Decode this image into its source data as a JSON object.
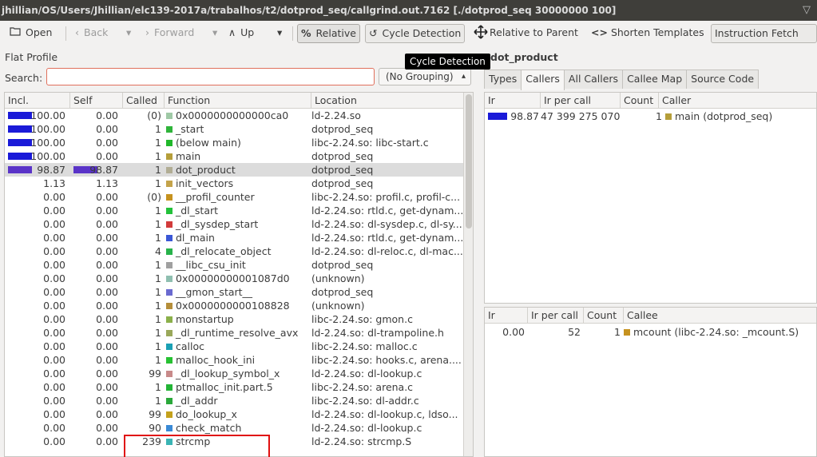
{
  "window": {
    "title": "jhillian/OS/Users/Jhillian/elc139-2017a/trabalhos/t2/dotprod_seq/callgrind.out.7162 [./dotprod_seq 30000000 100]"
  },
  "toolbar": {
    "open": "Open",
    "back": "Back",
    "forward": "Forward",
    "up": "Up",
    "relative": "Relative",
    "cycle_detection": "Cycle Detection",
    "relative_to_parent": "Relative to Parent",
    "shorten_templates": "Shorten Templates",
    "event_type": "Instruction Fetch"
  },
  "flat_profile": {
    "title": "Flat Profile",
    "search_label": "Search:",
    "search_value": "",
    "grouping": "(No Grouping)",
    "columns": [
      "Incl.",
      "Self",
      "Called",
      "Function",
      "Location"
    ],
    "rows": [
      {
        "incl": "100.00",
        "incl_frac": 1.0,
        "self": "0.00",
        "self_frac": 0.0,
        "called": "(0)",
        "func": "0x0000000000000ca0",
        "loc": "ld-2.24.so",
        "color": "#9fc9a6"
      },
      {
        "incl": "100.00",
        "incl_frac": 1.0,
        "self": "0.00",
        "self_frac": 0.0,
        "called": "1",
        "func": "_start",
        "loc": "dotprod_seq",
        "color": "#2fb43a"
      },
      {
        "incl": "100.00",
        "incl_frac": 1.0,
        "self": "0.00",
        "self_frac": 0.0,
        "called": "1",
        "func": "(below main)",
        "loc": "libc-2.24.so: libc-start.c",
        "color": "#21b82b"
      },
      {
        "incl": "100.00",
        "incl_frac": 1.0,
        "self": "0.00",
        "self_frac": 0.0,
        "called": "1",
        "func": "main",
        "loc": "dotprod_seq",
        "color": "#b59e3a"
      },
      {
        "incl": "98.87",
        "incl_frac": 0.9887,
        "self": "98.87",
        "self_frac": 0.9887,
        "called": "1",
        "func": "dot_product",
        "loc": "dotprod_seq",
        "color": "#b1ad94",
        "selected": true
      },
      {
        "incl": "1.13",
        "incl_frac": 0.0,
        "self": "1.13",
        "self_frac": 0.0,
        "called": "1",
        "func": "init_vectors",
        "loc": "dotprod_seq",
        "color": "#c4a34a"
      },
      {
        "incl": "0.00",
        "incl_frac": 0.0,
        "self": "0.00",
        "self_frac": 0.0,
        "called": "(0)",
        "func": "__profil_counter",
        "loc": "libc-2.24.so: profil.c, profil-c...",
        "color": "#c6921f"
      },
      {
        "incl": "0.00",
        "incl_frac": 0.0,
        "self": "0.00",
        "self_frac": 0.0,
        "called": "1",
        "func": "_dl_start",
        "loc": "ld-2.24.so: rtld.c, get-dynam...",
        "color": "#23c13a"
      },
      {
        "incl": "0.00",
        "incl_frac": 0.0,
        "self": "0.00",
        "self_frac": 0.0,
        "called": "1",
        "func": "_dl_sysdep_start",
        "loc": "ld-2.24.so: dl-sysdep.c, dl-sy...",
        "color": "#d23b3b"
      },
      {
        "incl": "0.00",
        "incl_frac": 0.0,
        "self": "0.00",
        "self_frac": 0.0,
        "called": "1",
        "func": "dl_main",
        "loc": "ld-2.24.so: rtld.c, get-dynam...",
        "color": "#3a57d6"
      },
      {
        "incl": "0.00",
        "incl_frac": 0.0,
        "self": "0.00",
        "self_frac": 0.0,
        "called": "4",
        "func": "_dl_relocate_object",
        "loc": "ld-2.24.so: dl-reloc.c, dl-mac...",
        "color": "#27b24a"
      },
      {
        "incl": "0.00",
        "incl_frac": 0.0,
        "self": "0.00",
        "self_frac": 0.0,
        "called": "1",
        "func": "__libc_csu_init",
        "loc": "dotprod_seq",
        "color": "#a0a0a0"
      },
      {
        "incl": "0.00",
        "incl_frac": 0.0,
        "self": "0.00",
        "self_frac": 0.0,
        "called": "1",
        "func": "0x00000000001087d0",
        "loc": "(unknown)",
        "color": "#8fbfb0"
      },
      {
        "incl": "0.00",
        "incl_frac": 0.0,
        "self": "0.00",
        "self_frac": 0.0,
        "called": "1",
        "func": "__gmon_start__",
        "loc": "dotprod_seq",
        "color": "#6a6ad0"
      },
      {
        "incl": "0.00",
        "incl_frac": 0.0,
        "self": "0.00",
        "self_frac": 0.0,
        "called": "1",
        "func": "0x0000000000108828",
        "loc": "(unknown)",
        "color": "#b58e3a"
      },
      {
        "incl": "0.00",
        "incl_frac": 0.0,
        "self": "0.00",
        "self_frac": 0.0,
        "called": "1",
        "func": "monstartup",
        "loc": "libc-2.24.so: gmon.c",
        "color": "#8bb04a"
      },
      {
        "incl": "0.00",
        "incl_frac": 0.0,
        "self": "0.00",
        "self_frac": 0.0,
        "called": "1",
        "func": "_dl_runtime_resolve_avx",
        "loc": "ld-2.24.so: dl-trampoline.h",
        "color": "#9aa85a"
      },
      {
        "incl": "0.00",
        "incl_frac": 0.0,
        "self": "0.00",
        "self_frac": 0.0,
        "called": "1",
        "func": "calloc",
        "loc": "libc-2.24.so: malloc.c",
        "color": "#1aa0b4"
      },
      {
        "incl": "0.00",
        "incl_frac": 0.0,
        "self": "0.00",
        "self_frac": 0.0,
        "called": "1",
        "func": "malloc_hook_ini",
        "loc": "libc-2.24.so: hooks.c, arena....",
        "color": "#27c132"
      },
      {
        "incl": "0.00",
        "incl_frac": 0.0,
        "self": "0.00",
        "self_frac": 0.0,
        "called": "99",
        "func": "_dl_lookup_symbol_x",
        "loc": "ld-2.24.so: dl-lookup.c",
        "color": "#c88a8a"
      },
      {
        "incl": "0.00",
        "incl_frac": 0.0,
        "self": "0.00",
        "self_frac": 0.0,
        "called": "1",
        "func": "ptmalloc_init.part.5",
        "loc": "libc-2.24.so: arena.c",
        "color": "#23b436"
      },
      {
        "incl": "0.00",
        "incl_frac": 0.0,
        "self": "0.00",
        "self_frac": 0.0,
        "called": "1",
        "func": "_dl_addr",
        "loc": "libc-2.24.so: dl-addr.c",
        "color": "#2aa83a"
      },
      {
        "incl": "0.00",
        "incl_frac": 0.0,
        "self": "0.00",
        "self_frac": 0.0,
        "called": "99",
        "func": "do_lookup_x",
        "loc": "ld-2.24.so: dl-lookup.c, ldso...",
        "color": "#c4a11c"
      },
      {
        "incl": "0.00",
        "incl_frac": 0.0,
        "self": "0.00",
        "self_frac": 0.0,
        "called": "90",
        "func": "check_match",
        "loc": "ld-2.24.so: dl-lookup.c",
        "color": "#3a8ad6"
      },
      {
        "incl": "0.00",
        "incl_frac": 0.0,
        "self": "0.00",
        "self_frac": 0.0,
        "called": "239",
        "func": "strcmp",
        "loc": "ld-2.24.so: strcmp.S",
        "color": "#3ab4b4"
      }
    ]
  },
  "tooltip": "Cycle Detection",
  "right_panel": {
    "title": "dot_product",
    "tabs": [
      "Types",
      "Callers",
      "All Callers",
      "Callee Map",
      "Source Code"
    ],
    "active_tab": 1,
    "callers": {
      "columns": [
        "Ir",
        "Ir per call",
        "Count",
        "Caller"
      ],
      "rows": [
        {
          "ir": "98.87",
          "ir_frac": 0.9887,
          "per_call": "47 399 275 070",
          "count": "1",
          "name": "main (dotprod_seq)",
          "color": "#b59e3a"
        }
      ]
    },
    "callees": {
      "columns": [
        "Ir",
        "Ir per call",
        "Count",
        "Callee"
      ],
      "rows": [
        {
          "ir": "0.00",
          "per_call": "52",
          "count": "1",
          "name": "mcount (libc-2.24.so: _mcount.S)",
          "color": "#c6921f"
        }
      ]
    }
  }
}
